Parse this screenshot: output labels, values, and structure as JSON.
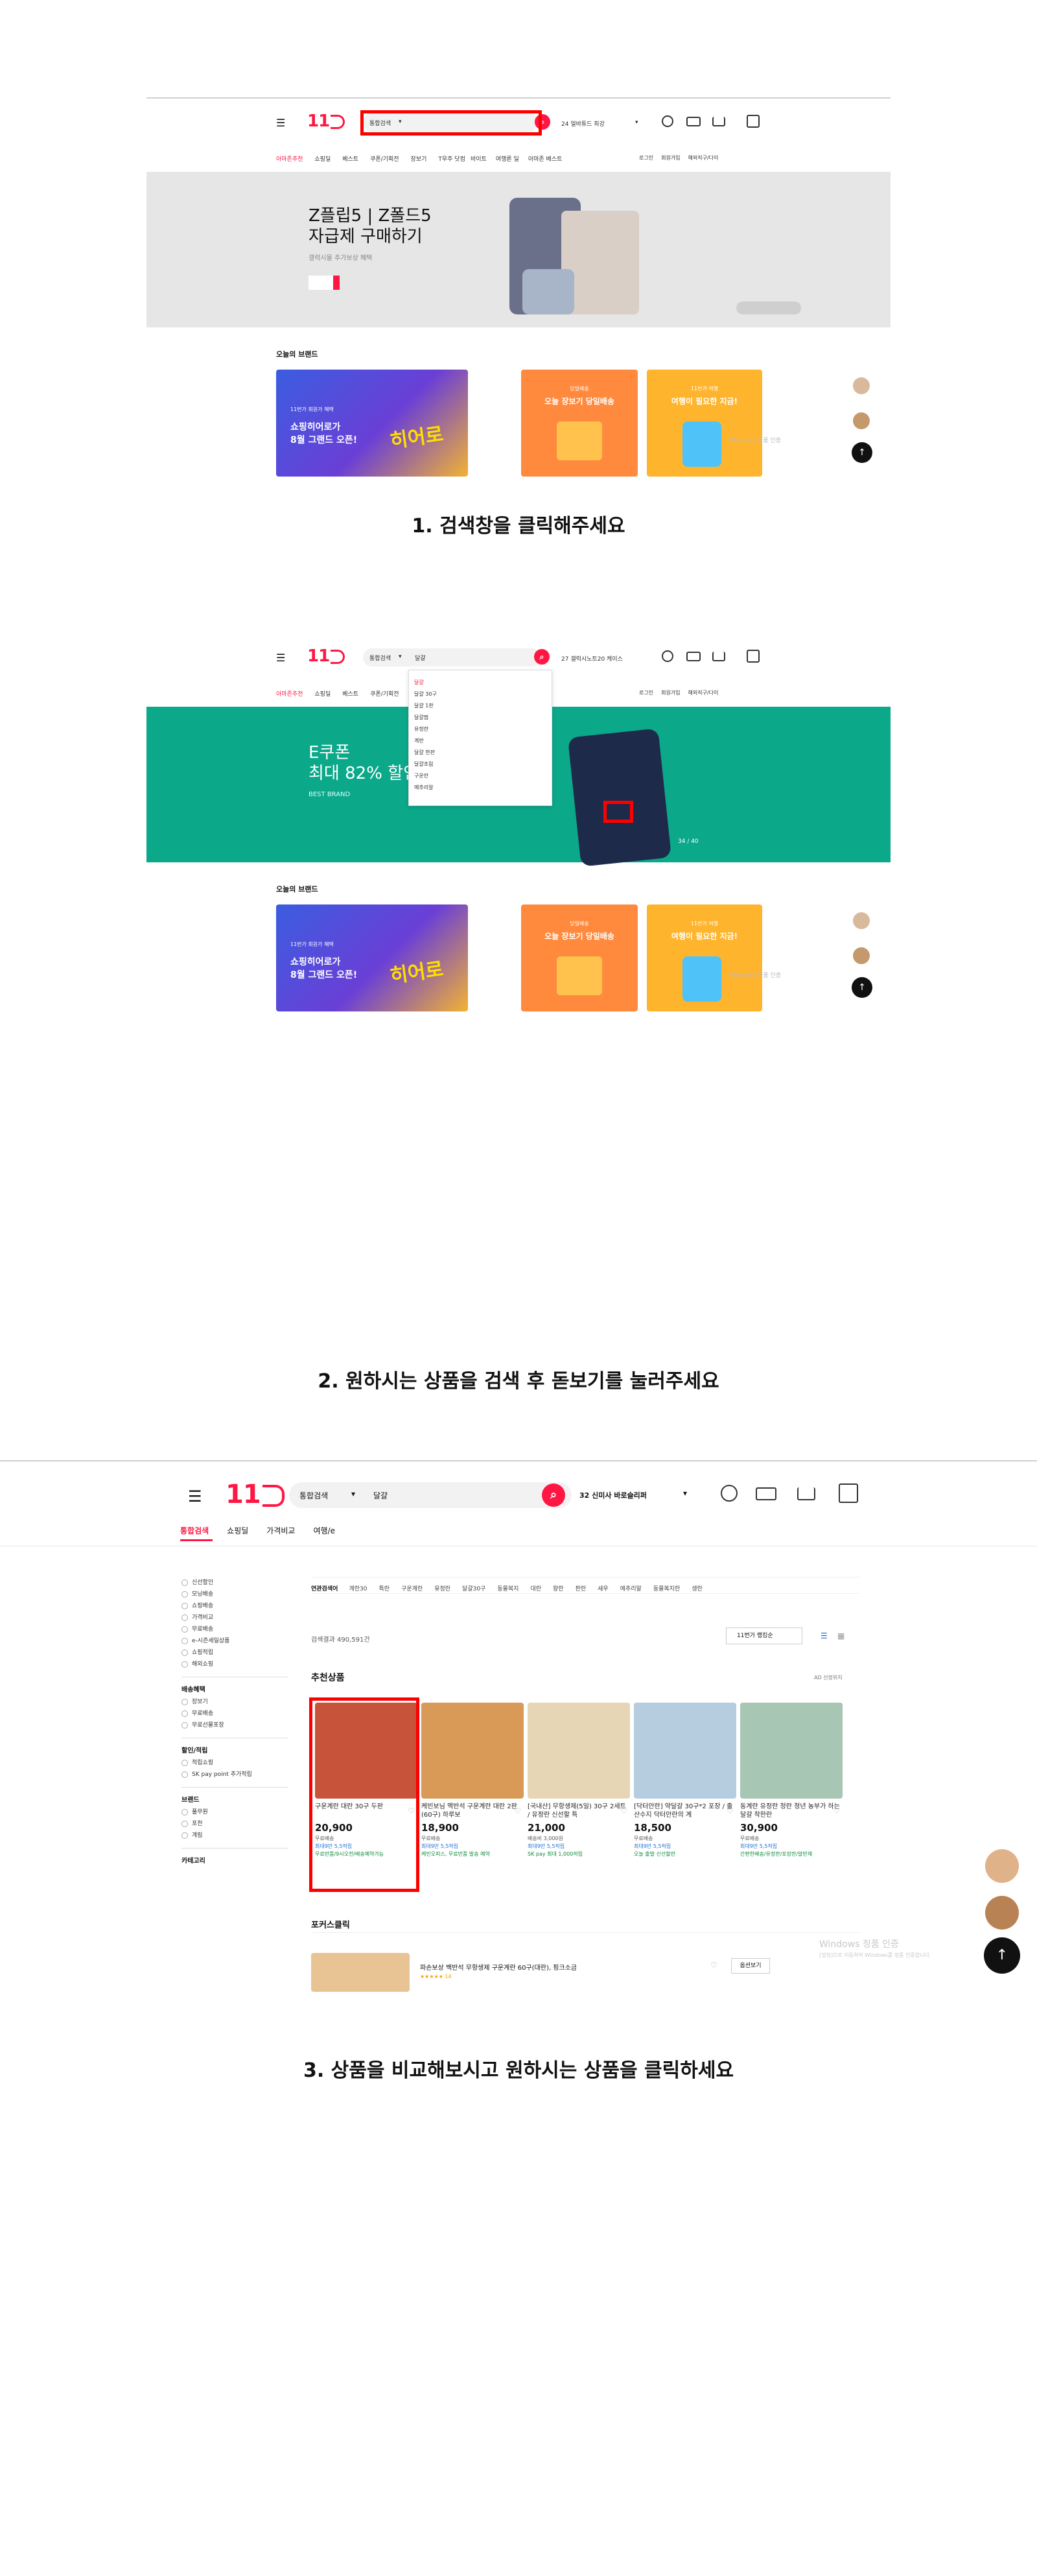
{
  "colors": {
    "brand": "#ff1744",
    "highlight": "#ff0000",
    "banner1": "#e6e6e6",
    "banner2": "#0ba88a"
  },
  "common": {
    "logo": "11",
    "promo_chip": "7%",
    "todays_brand": "오늘의 브랜드",
    "card1_line1": "11번가 회원가 혜택",
    "card1_line2": "쇼핑히어로가",
    "card1_line3": "8월 그랜드 오픈!",
    "card1_badge": "히어로",
    "card2_tag": "당일배송",
    "card2_title": "오늘 장보기 당일배송",
    "card3_tag": "11번가 여행",
    "card3_title": "여행이 필요한 지금!",
    "watermark1": "Windows 정품 인증",
    "watermark2": "[설정]으로 이동하여 Windows를 정품 인증합니다."
  },
  "step1": {
    "search_category": "통합검색",
    "header_right": "24 얼바튜드 최강",
    "nav": [
      "아마존추천",
      "쇼핑딜",
      "베스트",
      "쿠폰/기획전",
      "장보기",
      "T우주 닷컴"
    ],
    "nav_center": [
      "바이트",
      "여행론 딜",
      "아마존 베스트"
    ],
    "nav_right": [
      "로그인",
      "회원가입",
      "해외직구/다이"
    ],
    "banner_title1": "Z플립5 | Z폴드5",
    "banner_title2": "자급제 구매하기",
    "banner_sub": "갤럭시몰 추가보상 혜택",
    "caption": "1. 검색창을 클릭해주세요"
  },
  "step2": {
    "search_category": "통합검색",
    "search_value": "달걀",
    "header_right": "27 갤럭시노트20 케이스",
    "suggestions": [
      "달걀",
      "달걀 30구",
      "달걀 1판",
      "달걀찜",
      "유정란",
      "계란",
      "달걀 한판",
      "달걀조림",
      "구운란",
      "메추리알"
    ],
    "banner_title1": "E쿠폰",
    "banner_title2": "최대 82% 할인",
    "banner_sub": "BEST BRAND",
    "banner_page": "34 / 40",
    "caption": "2. 원하시는 상품을 검색 후 돋보기를 눌러주세요"
  },
  "step3": {
    "search_category": "통합검색",
    "search_value": "달걀",
    "header_right": "32 신미사 바로슬리퍼",
    "tabs": [
      "통합검색",
      "쇼핑딜",
      "가격비교",
      "여행/e"
    ],
    "filters_top": [
      "신선할인",
      "모닝배송",
      "쇼핑배송",
      "가격비교",
      "무료배송",
      "e-시즌세일상품",
      "쇼핑적립",
      "해외쇼핑"
    ],
    "filter_group1": "배송혜택",
    "filter_group1_items": [
      "장보기",
      "무료배송",
      "무료선물포장"
    ],
    "filter_group2": "할인/적립",
    "filter_group2_items": [
      "적립쇼핑",
      "SK pay point 추가적립"
    ],
    "filter_group3": "브랜드",
    "filter_group3_items": [
      "풀무원",
      "포천",
      "계림"
    ],
    "filter_group4": "카테고리",
    "related_label": "연관검색어",
    "related": [
      "계란30",
      "특란",
      "구운계란",
      "유정란",
      "달걀30구",
      "동물복지",
      "대란",
      "왕란",
      "판란",
      "새우",
      "메추리알",
      "동물복지란",
      "생란"
    ],
    "result_count": "검색결과 490,591건",
    "sort": "11번가 랭킹순",
    "rec_title": "추천상품",
    "ad_info": "AD 선정위치",
    "products": [
      {
        "name": "구운계란 대란 30구 두판",
        "price": "20,900",
        "sub": "무료배송",
        "blue": "최대9만 5,5적립",
        "green": "무료반품/9시오전/배송예약가능"
      },
      {
        "name": "케빈보님 맥반석 구운계란 대란 2판(60구) 하루보",
        "price": "18,900",
        "sub": "무료배송",
        "blue": "최대9만 5,5적립",
        "green": "케빈오피스, 무료반품 발송 예약"
      },
      {
        "name": "[국내산] 무항생제(5일) 30구 2세트 / 유정란 신선할 특",
        "price": "21,000",
        "sub": "배송비 3,000원",
        "blue": "최대9만 5,5적립",
        "green": "SK pay 최대 1,000적립"
      },
      {
        "name": "[닥터안란] 약달걀 30구*2 포장 / 출산수지 닥터안란의 계",
        "price": "18,500",
        "sub": "무료배송",
        "blue": "최대9만 5,5적립",
        "green": "오늘 출발 신선할란"
      },
      {
        "name": "동계란 유정란 청란 청년 농부가 하는 달걀 착한란",
        "price": "30,900",
        "sub": "무료배송",
        "blue": "최대9만 5,5적립",
        "green": "간편한배송/유정란/포장란/알반재"
      }
    ],
    "focus_title": "포커스클릭",
    "focus_item": "파손보상 백반석 무항생제 구운계란 60구(대란), 핑크소금",
    "focus_rating": "★★★★★ 14",
    "focus_btn": "옵션보기",
    "caption": "3. 상품을 비교해보시고 원하시는 상품을 클릭하세요"
  }
}
